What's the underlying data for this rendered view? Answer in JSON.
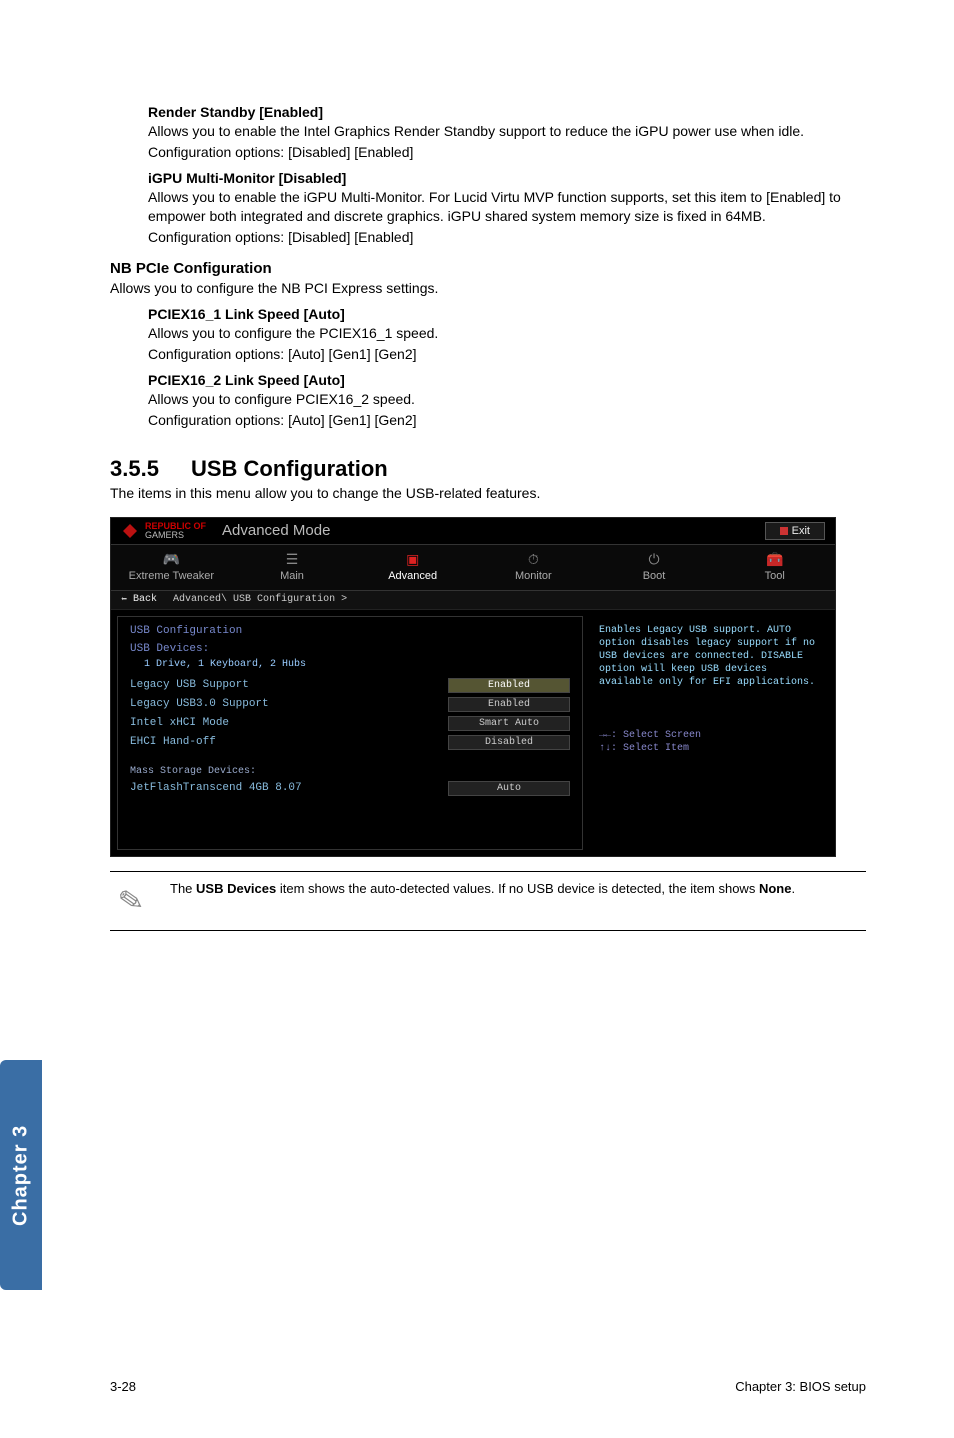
{
  "render_standby": {
    "heading": "Render Standby [Enabled]",
    "desc": "Allows you to enable the Intel Graphics Render Standby support to reduce the iGPU power use when idle.",
    "config": "Configuration options: [Disabled] [Enabled]"
  },
  "igpu_mm": {
    "heading": "iGPU Multi-Monitor [Disabled]",
    "desc": "Allows you to enable the iGPU Multi-Monitor. For Lucid Virtu MVP function supports, set this item to [Enabled] to empower both integrated and discrete graphics. iGPU shared system memory size is fixed in 64MB.",
    "config": "Configuration options: [Disabled] [Enabled]"
  },
  "nb_pcie": {
    "heading": "NB PCIe Configuration",
    "desc": "Allows you to configure the NB PCI Express settings."
  },
  "pciex16_1": {
    "heading": "PCIEX16_1 Link Speed [Auto]",
    "desc": "Allows you to configure the PCIEX16_1 speed.",
    "config": "Configuration options: [Auto] [Gen1] [Gen2]"
  },
  "pciex16_2": {
    "heading": "PCIEX16_2 Link Speed [Auto]",
    "desc": "Allows you to configure PCIEX16_2 speed.",
    "config": "Configuration options: [Auto] [Gen1] [Gen2]"
  },
  "section": {
    "num": "3.5.5",
    "title": "USB Configuration",
    "desc": "The items in this menu allow you to change the USB-related features."
  },
  "bios": {
    "brand1": "REPUBLIC OF",
    "brand2": "GAMERS",
    "mode": "Advanced Mode",
    "exit": "Exit",
    "tabs": {
      "extreme": "Extreme Tweaker",
      "main": "Main",
      "advanced": "Advanced",
      "monitor": "Monitor",
      "boot": "Boot",
      "tool": "Tool"
    },
    "back": "Back",
    "crumb": "Advanced\\ USB Configuration >",
    "cfg_head": "USB Configuration",
    "dev_head": "USB Devices:",
    "dev_list": "1 Drive, 1 Keyboard, 2 Hubs",
    "rows": {
      "legacy": {
        "label": "Legacy USB Support",
        "value": "Enabled"
      },
      "legacy30": {
        "label": "Legacy USB3.0 Support",
        "value": "Enabled"
      },
      "xhci": {
        "label": "Intel xHCI Mode",
        "value": "Smart Auto"
      },
      "ehci": {
        "label": "EHCI Hand-off",
        "value": "Disabled"
      }
    },
    "storage_head": "Mass Storage Devices:",
    "storage_item": {
      "label": "JetFlashTranscend 4GB 8.07",
      "value": "Auto"
    },
    "help": "Enables Legacy USB support. AUTO option disables legacy support if no USB devices are connected. DISABLE option will keep USB devices available only for EFI applications.",
    "nav1": "→←: Select Screen",
    "nav2": "↑↓: Select Item"
  },
  "note": {
    "pre": "The ",
    "bold1": "USB Devices",
    "mid": " item shows the auto-detected values. If no USB device is detected, the item shows ",
    "bold2": "None",
    "post": "."
  },
  "chapter_tab": "Chapter 3",
  "footer": {
    "left": "3-28",
    "right": "Chapter 3: BIOS setup"
  }
}
